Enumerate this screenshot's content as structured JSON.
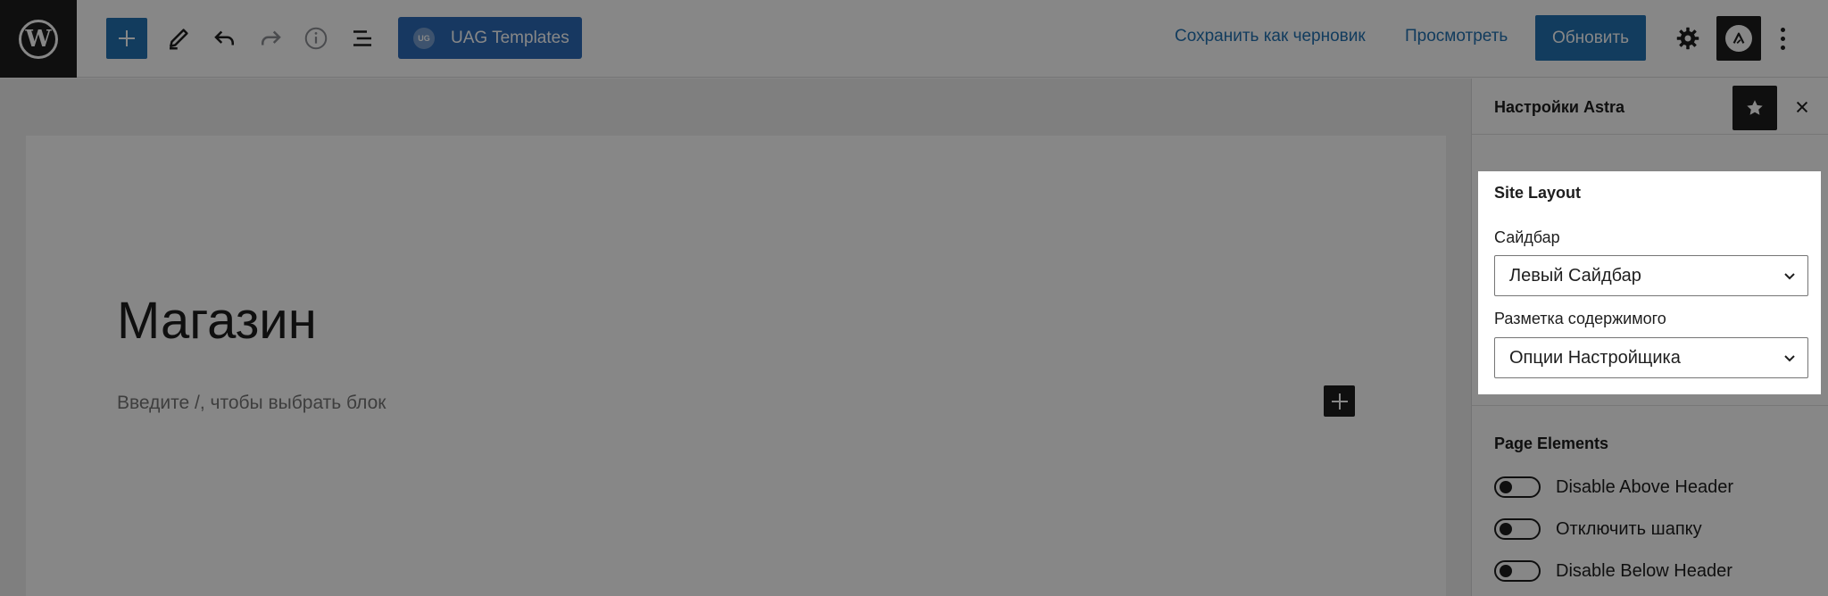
{
  "toolbar": {
    "wp_logo_letter": "W",
    "uag_badge": "UG",
    "uag_label": "UAG Templates",
    "save_draft_label": "Сохранить как черновик",
    "preview_label": "Просмотреть",
    "update_label": "Обновить"
  },
  "editor": {
    "page_title": "Магазин",
    "block_placeholder": "Введите /, чтобы выбрать блок"
  },
  "sidebar": {
    "title": "Настройки Astra",
    "site_layout": {
      "heading": "Site Layout",
      "sidebar_label": "Сайдбар",
      "sidebar_value": "Левый Сайдбар",
      "content_layout_label": "Разметка содержимого",
      "content_layout_value": "Опции Настройщика"
    },
    "page_elements": {
      "heading": "Page Elements",
      "toggles": [
        {
          "label": "Disable Above Header",
          "on": false
        },
        {
          "label": "Отключить шапку",
          "on": false
        },
        {
          "label": "Disable Below Header",
          "on": false
        }
      ]
    }
  },
  "colors": {
    "accent": "#2271b1",
    "uag": "#2d6bb7",
    "dark": "#1e1e1e",
    "overlay": "rgba(0,0,0,0.47)"
  }
}
